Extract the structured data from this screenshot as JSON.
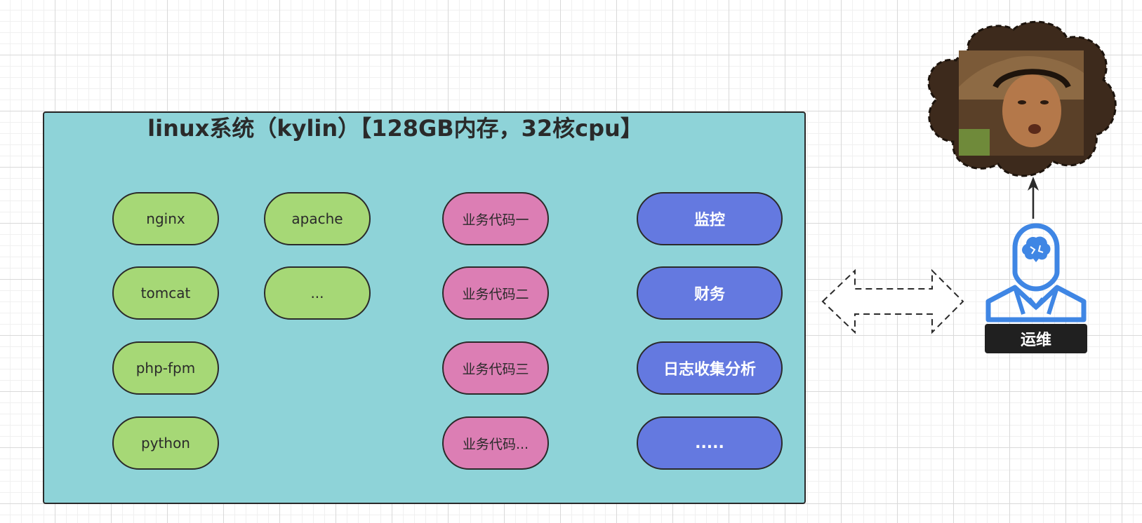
{
  "system": {
    "title": "linux系统（kylin）【128GB内存，32核cpu】"
  },
  "services": {
    "green": [
      "nginx",
      "apache",
      "tomcat",
      "...",
      "php-fpm",
      "python"
    ],
    "pink": [
      "业务代码一",
      "业务代码二",
      "业务代码三",
      "业务代码..."
    ],
    "blue": [
      "监控",
      "财务",
      "日志收集分析",
      "....."
    ]
  },
  "ops": {
    "label": "运维",
    "icon": "brain-person-icon"
  },
  "photo": {
    "icon": "cloud-photo-icon"
  },
  "colors": {
    "system_bg": "#8ed3d8",
    "green": "#a6d876",
    "pink": "#dc7eb4",
    "blue": "#6479e0",
    "ops_blue": "#3f86e4",
    "cloud": "#3d2a1c"
  }
}
